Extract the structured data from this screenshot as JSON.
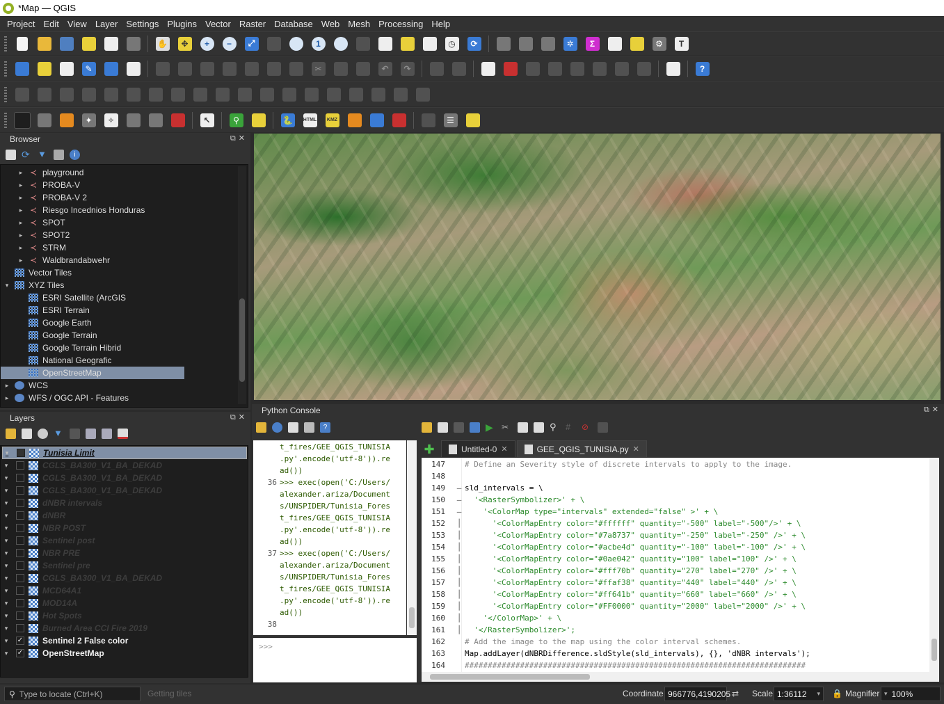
{
  "window": {
    "title": "*Map — QGIS"
  },
  "menu": [
    "Project",
    "Edit",
    "View",
    "Layer",
    "Settings",
    "Plugins",
    "Vector",
    "Raster",
    "Database",
    "Web",
    "Mesh",
    "Processing",
    "Help"
  ],
  "browser": {
    "title": "Browser",
    "items": [
      {
        "label": "playground",
        "icon": "connection-icon",
        "indent": 1,
        "expander": "▸"
      },
      {
        "label": "PROBA-V",
        "icon": "connection-icon",
        "indent": 1,
        "expander": "▸"
      },
      {
        "label": "PROBA-V 2",
        "icon": "connection-icon",
        "indent": 1,
        "expander": "▸"
      },
      {
        "label": "Riesgo Incednios Honduras",
        "icon": "connection-icon",
        "indent": 1,
        "expander": "▸"
      },
      {
        "label": "SPOT",
        "icon": "connection-icon",
        "indent": 1,
        "expander": "▸"
      },
      {
        "label": "SPOT2",
        "icon": "connection-icon",
        "indent": 1,
        "expander": "▸"
      },
      {
        "label": "STRM",
        "icon": "connection-icon",
        "indent": 1,
        "expander": "▸"
      },
      {
        "label": "Waldbrandabwehr",
        "icon": "connection-icon",
        "indent": 1,
        "expander": "▸"
      },
      {
        "label": "Vector Tiles",
        "icon": "grid-icon",
        "indent": 0,
        "expander": ""
      },
      {
        "label": "XYZ Tiles",
        "icon": "grid-icon",
        "indent": 0,
        "expander": "▾"
      },
      {
        "label": "ESRI Satellite (ArcGIS",
        "icon": "grid-icon",
        "indent": 1,
        "expander": ""
      },
      {
        "label": "ESRI Terrain",
        "icon": "grid-icon",
        "indent": 1,
        "expander": ""
      },
      {
        "label": "Google Earth",
        "icon": "grid-icon",
        "indent": 1,
        "expander": ""
      },
      {
        "label": "Google Terrain",
        "icon": "grid-icon",
        "indent": 1,
        "expander": ""
      },
      {
        "label": "Google Terrain Hibrid",
        "icon": "grid-icon",
        "indent": 1,
        "expander": ""
      },
      {
        "label": "National Geografic",
        "icon": "grid-icon",
        "indent": 1,
        "expander": ""
      },
      {
        "label": "OpenStreetMap",
        "icon": "grid-icon",
        "indent": 1,
        "expander": "",
        "selected": true
      },
      {
        "label": "WCS",
        "icon": "globe-icon",
        "indent": 0,
        "expander": "▸"
      },
      {
        "label": "WFS / OGC API - Features",
        "icon": "globe-icon",
        "indent": 0,
        "expander": "▸"
      }
    ]
  },
  "layers": {
    "title": "Layers",
    "items": [
      {
        "label": "Tunisia Limit",
        "checked": false,
        "visible": true,
        "first": true
      },
      {
        "label": "CGLS_BA300_V1_BA_DEKAD",
        "checked": false,
        "visible": false
      },
      {
        "label": "CGLS_BA300_V1_BA_DEKAD",
        "checked": false,
        "visible": false
      },
      {
        "label": "CGLS_BA300_V1_BA_DEKAD",
        "checked": false,
        "visible": false
      },
      {
        "label": "dNBR intervals",
        "checked": false,
        "visible": false
      },
      {
        "label": "dNBR",
        "checked": false,
        "visible": false
      },
      {
        "label": "NBR POST",
        "checked": false,
        "visible": false
      },
      {
        "label": "Sentinel post",
        "checked": false,
        "visible": false
      },
      {
        "label": "NBR PRE",
        "checked": false,
        "visible": false
      },
      {
        "label": "Sentinel pre",
        "checked": false,
        "visible": false
      },
      {
        "label": "CGLS_BA300_V1_BA_DEKAD",
        "checked": false,
        "visible": false
      },
      {
        "label": "MCD64A1",
        "checked": false,
        "visible": false
      },
      {
        "label": "MOD14A",
        "checked": false,
        "visible": false
      },
      {
        "label": "Hot Spots",
        "checked": false,
        "visible": false
      },
      {
        "label": "Burned Area CCI Fire 2019",
        "checked": false,
        "visible": false
      },
      {
        "label": "Sentinel 2 False color",
        "checked": true,
        "visible": true
      },
      {
        "label": "OpenStreetMap",
        "checked": true,
        "visible": true
      }
    ]
  },
  "python_console": {
    "title": "Python Console",
    "shell_lines": [
      {
        "n": "",
        "t": "t_fires/GEE_QGIS_TUNISIA"
      },
      {
        "n": "",
        "t": ".py'.encode('utf-8')).re"
      },
      {
        "n": "",
        "t": "ad())"
      },
      {
        "n": "36",
        "t": ">>> exec(open('C:/Users/"
      },
      {
        "n": "",
        "t": "alexander.ariza/Document"
      },
      {
        "n": "",
        "t": "s/UNSPIDER/Tunisia_Fores"
      },
      {
        "n": "",
        "t": "t_fires/GEE_QGIS_TUNISIA"
      },
      {
        "n": "",
        "t": ".py'.encode('utf-8')).re"
      },
      {
        "n": "",
        "t": "ad())"
      },
      {
        "n": "37",
        "t": ">>> exec(open('C:/Users/"
      },
      {
        "n": "",
        "t": "alexander.ariza/Document"
      },
      {
        "n": "",
        "t": "s/UNSPIDER/Tunisia_Fores"
      },
      {
        "n": "",
        "t": "t_fires/GEE_QGIS_TUNISIA"
      },
      {
        "n": "",
        "t": ".py'.encode('utf-8')).re"
      },
      {
        "n": "",
        "t": "ad())"
      },
      {
        "n": "38",
        "t": ""
      }
    ],
    "prompt": ">>>",
    "tabs": [
      {
        "label": "Untitled-0",
        "active": false
      },
      {
        "label": "GEE_QGIS_TUNISIA.py",
        "active": true
      }
    ],
    "editor_lines": [
      {
        "n": "147",
        "t": "# Define an Severity style of discrete intervals to apply to the image.",
        "cls": "c-cmt",
        "fold": ""
      },
      {
        "n": "148",
        "t": "",
        "cls": "",
        "fold": ""
      },
      {
        "n": "149",
        "t": "sld_intervals = \\",
        "cls": "",
        "fold": "—"
      },
      {
        "n": "150",
        "t": "  '<RasterSymbolizer>' + \\",
        "cls": "c-str",
        "fold": "—"
      },
      {
        "n": "151",
        "t": "    '<ColorMap type=\"intervals\" extended=\"false\" >' + \\",
        "cls": "c-str",
        "fold": "—"
      },
      {
        "n": "152",
        "t": "      '<ColorMapEntry color=\"#ffffff\" quantity=\"-500\" label=\"-500\"/>' + \\",
        "cls": "c-str",
        "fold": "│"
      },
      {
        "n": "153",
        "t": "      '<ColorMapEntry color=\"#7a8737\" quantity=\"-250\" label=\"-250\" />' + \\",
        "cls": "c-str",
        "fold": "│"
      },
      {
        "n": "154",
        "t": "      '<ColorMapEntry color=\"#acbe4d\" quantity=\"-100\" label=\"-100\" />' + \\",
        "cls": "c-str",
        "fold": "│"
      },
      {
        "n": "155",
        "t": "      '<ColorMapEntry color=\"#0ae042\" quantity=\"100\" label=\"100\" />' + \\",
        "cls": "c-str",
        "fold": "│"
      },
      {
        "n": "156",
        "t": "      '<ColorMapEntry color=\"#fff70b\" quantity=\"270\" label=\"270\" />' + \\",
        "cls": "c-str",
        "fold": "│"
      },
      {
        "n": "157",
        "t": "      '<ColorMapEntry color=\"#ffaf38\" quantity=\"440\" label=\"440\" />' + \\",
        "cls": "c-str",
        "fold": "│"
      },
      {
        "n": "158",
        "t": "      '<ColorMapEntry color=\"#ff641b\" quantity=\"660\" label=\"660\" />' + \\",
        "cls": "c-str",
        "fold": "│"
      },
      {
        "n": "159",
        "t": "      '<ColorMapEntry color=\"#FF0000\" quantity=\"2000\" label=\"2000\" />' + \\",
        "cls": "c-str",
        "fold": "│"
      },
      {
        "n": "160",
        "t": "    '</ColorMap>' + \\",
        "cls": "c-str",
        "fold": "│"
      },
      {
        "n": "161",
        "t": "  '</RasterSymbolizer>';",
        "cls": "c-str",
        "fold": "│"
      },
      {
        "n": "162",
        "t": "# Add the image to the map using the color interval schemes.",
        "cls": "c-cmt",
        "fold": ""
      },
      {
        "n": "163",
        "t": "Map.addLayer(dNBRDifference.sldStyle(sld_intervals), {}, 'dNBR intervals');",
        "cls": "",
        "fold": ""
      },
      {
        "n": "164",
        "t": "##########################################################################",
        "cls": "c-cmt",
        "fold": ""
      }
    ]
  },
  "status": {
    "locate_placeholder": "Type to locate (Ctrl+K)",
    "message": "Getting tiles",
    "coordinate_label": "Coordinate",
    "coordinate": "966776,4190205",
    "scale_label": "Scale",
    "scale": "1:36112",
    "magnifier_label": "Magnifier",
    "magnifier": "100%"
  }
}
